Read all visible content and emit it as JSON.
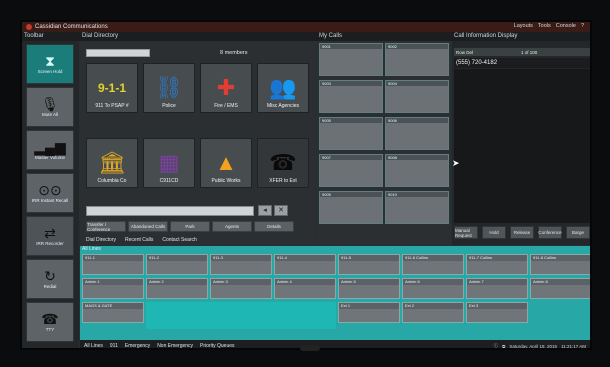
{
  "window": {
    "title": "Cassidian Communications",
    "menu": [
      "Layouts",
      "Tools",
      "Console",
      "?"
    ]
  },
  "topbar": {
    "toolbar": "Toolbar",
    "dial_directory": "Dial Directory",
    "my_calls": "My Calls",
    "call_info": "Call Information Display"
  },
  "sidebar": [
    {
      "label": "Screen Hold",
      "icon": "phone-hold-icon"
    },
    {
      "label": "Mute All",
      "icon": "microphone-icon"
    },
    {
      "label": "Master Volume",
      "icon": "volume-bars-icon"
    },
    {
      "label": "IRR Instant Recall",
      "icon": "voicemail-icon"
    },
    {
      "label": "IRR Recorder",
      "icon": "transfer-icon"
    },
    {
      "label": "Redial",
      "icon": "redial-icon"
    },
    {
      "label": "TTY",
      "icon": "tty-icon"
    }
  ],
  "dial": {
    "search_value": "",
    "members": "8 members",
    "tiles": [
      {
        "label": "911 To PSAP #",
        "glyph": "9-1-1",
        "color": "#e7d227",
        "icon": "911-icon"
      },
      {
        "label": "Police",
        "glyph": "⛓",
        "color": "#2f79c9",
        "icon": "police-icon"
      },
      {
        "label": "Fire / EMS",
        "glyph": "✚",
        "color": "#e33c33",
        "icon": "fire-ems-icon"
      },
      {
        "label": "Misc Agencies",
        "glyph": "👥",
        "color": "#55b84a",
        "icon": "agencies-icon"
      },
      {
        "label": "Columbia Co",
        "glyph": "🏛",
        "color": "#e0a823",
        "icon": "building-icon"
      },
      {
        "label": "C911CD",
        "glyph": "▦",
        "color": "#7d3fa3",
        "icon": "phone-book-icon"
      },
      {
        "label": "Public Works",
        "glyph": "▲",
        "color": "#f2a020",
        "icon": "cone-icon"
      },
      {
        "label": "XFER to Ext",
        "glyph": "☎",
        "color": "#111111",
        "icon": "transfer-phone-icon"
      }
    ],
    "actions": [
      "Transfer / Conference",
      "Abandoned Calls",
      "Park",
      "Agents",
      "Details"
    ],
    "tabs": [
      "Dial Directory",
      "Recent Calls",
      "Contact Search"
    ]
  },
  "mycalls": {
    "slots": [
      "9001",
      "9002",
      "9003",
      "9004",
      "9005",
      "9006",
      "9007",
      "9008",
      "9009",
      "9010"
    ]
  },
  "callinfo": {
    "row": "Row Del",
    "row_right": "1 of 100",
    "number": "(555) 720-4182",
    "buttons": [
      "Manual Request",
      "Hold",
      "Release",
      "Conference",
      "Barge"
    ]
  },
  "alllines": {
    "title": "All Lines",
    "lines": [
      "911-1",
      "911-2",
      "911-3",
      "911-4",
      "911-5",
      "911-6 Collins",
      "911-7 Collins",
      "911-8 Collins",
      "Admin 1",
      "Admin 2",
      "Admin 3",
      "Admin 4",
      "Admin 5",
      "Admin 6",
      "Admin 7",
      "Admin 8",
      "MAGS & GATE",
      "",
      "",
      "",
      "",
      "Ext 1",
      "Ext 2",
      "Ext 3"
    ],
    "tabs": [
      "All Lines",
      "911",
      "Emergency",
      "Non Emergency",
      "Priority Queues"
    ]
  },
  "status": {
    "date": "Saturday, April 18, 2015",
    "time": "11:21:17 AM"
  }
}
